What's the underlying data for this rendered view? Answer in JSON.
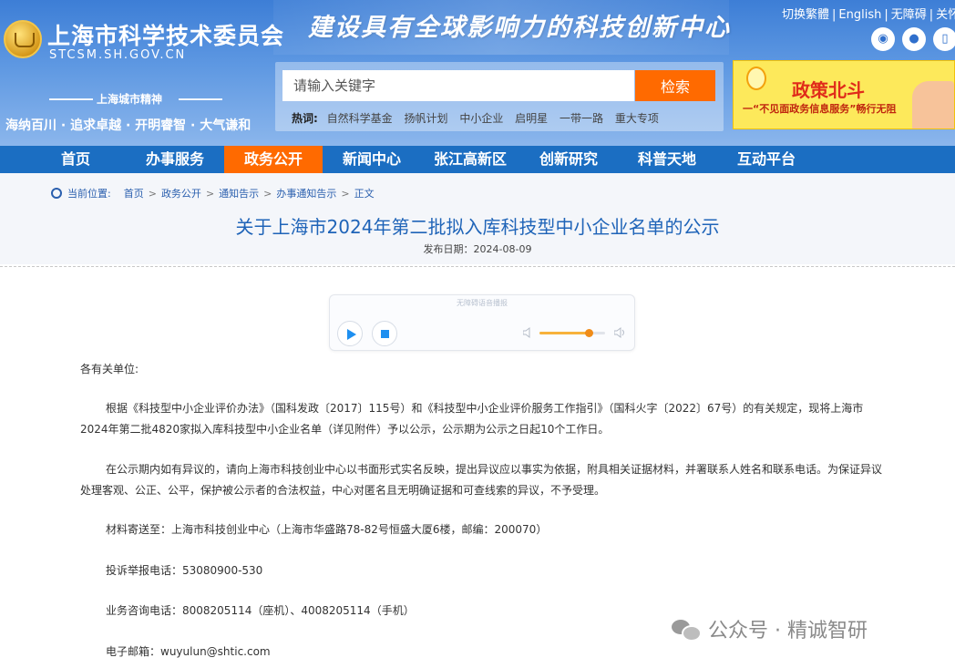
{
  "header": {
    "site_title": "上海市科学技术委员会",
    "site_domain": "STCSM.SH.GOV.CN",
    "slogan": "建设具有全球影响力的科技创新中心",
    "top_links": [
      "切换繁體",
      "English",
      "无障碍",
      "关怀版"
    ],
    "social_icons": [
      "weibo-icon",
      "wechat-icon",
      "mobile-icon"
    ],
    "spirit_label": "上海城市精神",
    "spirit_text": "海纳百川 · 追求卓越 · 开明睿智 · 大气谦和"
  },
  "search": {
    "placeholder": "请输入关键字",
    "button_label": "检索",
    "hot_label": "热词:",
    "hot_words": [
      "自然科学基金",
      "扬帆计划",
      "中小企业",
      "启明星",
      "一带一路",
      "重大专项"
    ]
  },
  "banner": {
    "title": "政策北斗",
    "subtitle": "一“不见面政务信息服务”畅行无阻"
  },
  "nav": {
    "items": [
      "首页",
      "办事服务",
      "政务公开",
      "新闻中心",
      "张江高新区",
      "创新研究",
      "科普天地",
      "互动平台"
    ],
    "active_index": 2
  },
  "breadcrumb": {
    "label": "当前位置:",
    "items": [
      "首页",
      "政务公开",
      "通知告示",
      "办事通知告示",
      "正文"
    ]
  },
  "article": {
    "title": "关于上海市2024年第二批拟入库科技型中小企业名单的公示",
    "publish_date": "发布日期：2024-08-09",
    "player": {
      "note": "无障碍语音播报",
      "volume_level": 0.75
    },
    "salutation": "各有关单位:",
    "paragraphs": [
      "根据《科技型中小企业评价办法》（国科发政〔2017〕115号）和《科技型中小企业评价服务工作指引》（国科火字〔2022〕67号）的有关规定，现将上海市2024年第二批4820家拟入库科技型中小企业名单（详见附件）予以公示，公示期为公示之日起10个工作日。",
      "在公示期内如有异议的，请向上海市科技创业中心以书面形式实名反映，提出异议应以事实为依据，附具相关证据材料，并署联系人姓名和联系电话。为保证异议处理客观、公正、公平，保护被公示者的合法权益，中心对匿名且无明确证据和可查线索的异议，不予受理。"
    ],
    "address_line": "材料寄送至：上海市科技创业中心（上海市华盛路78-82号恒盛大厦6楼，邮编：200070）",
    "complaint_line": "投诉举报电话：53080900-530",
    "consult_line": "业务咨询电话：8008205114（座机）、4008205114（手机）",
    "email_line": "电子邮箱：wuyulun@shtic.com"
  },
  "watermark": {
    "text": "公众号 · 精诚智研"
  },
  "colors": {
    "header_blue": "#3d7ed6",
    "nav_blue": "#1b6ec2",
    "accent_orange": "#ff6a00",
    "title_blue": "#1f64b8",
    "banner_yellow": "#fde95b",
    "player_blue": "#1e8ff0"
  }
}
